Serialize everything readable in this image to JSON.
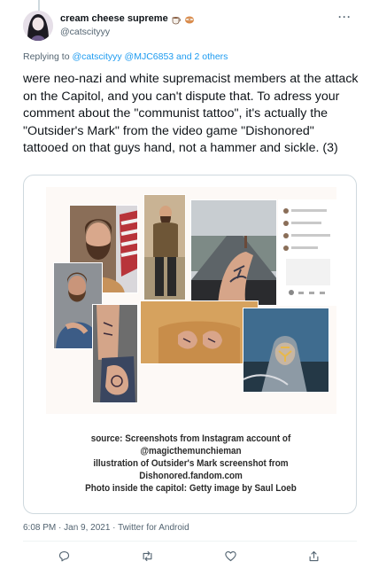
{
  "tweet": {
    "display_name": "cream cheese supreme",
    "handle": "@catscityyy",
    "reply_prefix": "Replying to ",
    "reply_mentions": "@catscityyy @MJC6853 and 2 others",
    "text": "were neo-nazi and white supremacist members at the attack on the Capitol, and you can't dispute that. To adress your comment about the \"communist tattoo\", it's actually the \"Outsider's Mark\" from the video game \"Dishonored\" tattooed on that guys hand, not a hammer and sickle. (3)",
    "meta": "6:08 PM · Jan 9, 2021 · Twitter for Android",
    "more_label": "···"
  },
  "image_card": {
    "caption_lines": [
      "source: Screenshots from Instagram account of",
      "@magicthemunchieman",
      "illustration of Outsider's Mark screenshot from",
      "Dishonored.fandom.com",
      "Photo inside the capitol: Getty image by Saul Loeb"
    ]
  },
  "icons": {
    "reply": "reply-icon",
    "retweet": "retweet-icon",
    "like": "heart-icon",
    "share": "share-icon",
    "more": "more-icon"
  },
  "colors": {
    "link": "#1d9bf0",
    "secondary_text": "#536471",
    "border": "#cfd9de"
  }
}
